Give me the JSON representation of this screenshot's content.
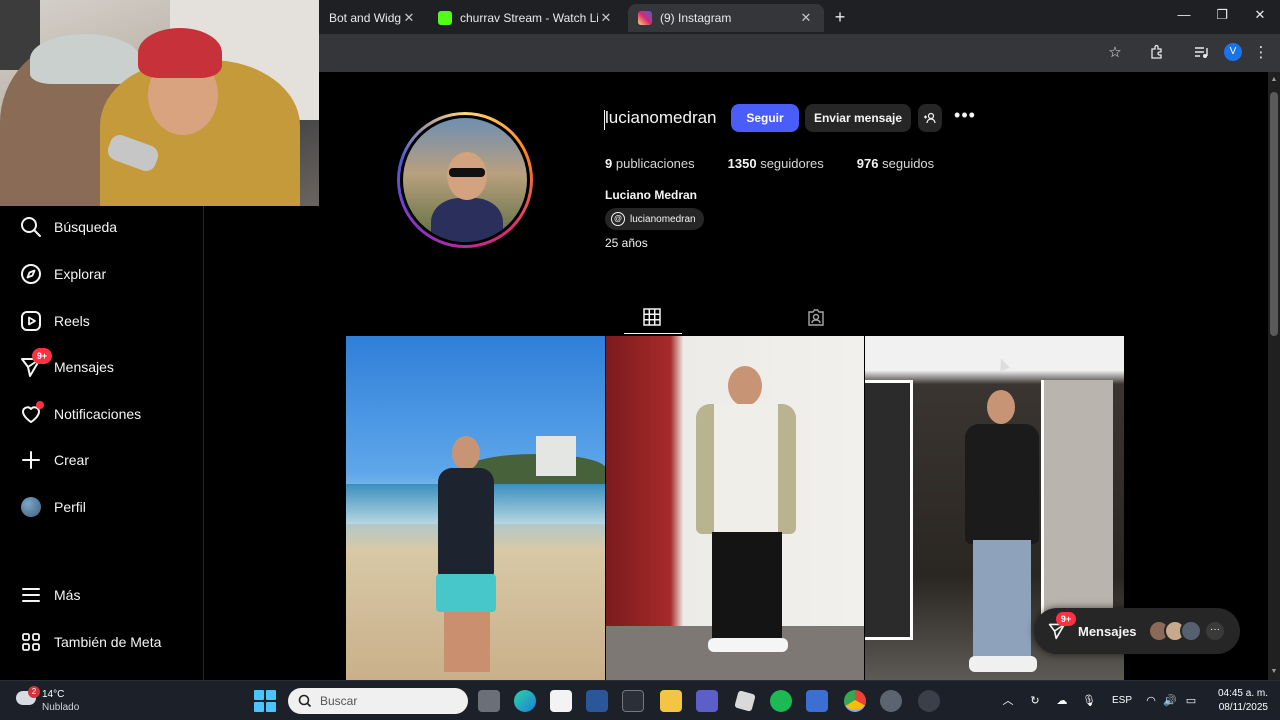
{
  "browser": {
    "tabs": [
      {
        "title": "Bot and Widgets",
        "active": false
      },
      {
        "title": "churrav Stream - Watch Live on",
        "active": false
      },
      {
        "title": "(9) Instagram",
        "active": true
      }
    ],
    "profile_initial": "V"
  },
  "sidebar": {
    "items": [
      {
        "label": "Búsqueda",
        "icon": "search-icon"
      },
      {
        "label": "Explorar",
        "icon": "compass-icon"
      },
      {
        "label": "Reels",
        "icon": "reels-icon"
      },
      {
        "label": "Mensajes",
        "icon": "messenger-icon",
        "badge": "9+"
      },
      {
        "label": "Notificaciones",
        "icon": "heart-icon",
        "dot": true
      },
      {
        "label": "Crear",
        "icon": "plus-icon"
      },
      {
        "label": "Perfil",
        "icon": "avatar"
      },
      {
        "label": "Más",
        "icon": "menu-icon"
      },
      {
        "label": "También de Meta",
        "icon": "meta-grid-icon"
      }
    ]
  },
  "profile": {
    "username": "lucianomedran",
    "follow_label": "Seguir",
    "message_label": "Enviar mensaje",
    "stats": {
      "posts_count": "9",
      "posts_label": "publicaciones",
      "followers_count": "1350",
      "followers_label": "seguidores",
      "following_count": "976",
      "following_label": "seguidos"
    },
    "full_name": "Luciano Medran",
    "threads_handle": "lucianomedran",
    "bio": "25 años"
  },
  "messages_pill": {
    "label": "Mensajes",
    "badge": "9+"
  },
  "taskbar": {
    "weather_temp": "14°C",
    "weather_desc": "Nublado",
    "weather_badge": "2",
    "search_placeholder": "Buscar",
    "language": "ESP",
    "time": "04:45 a. m.",
    "date": "08/11/2025"
  },
  "colors": {
    "follow_button": "#4a5df9",
    "badge": "#ff3040",
    "background": "#000000"
  }
}
